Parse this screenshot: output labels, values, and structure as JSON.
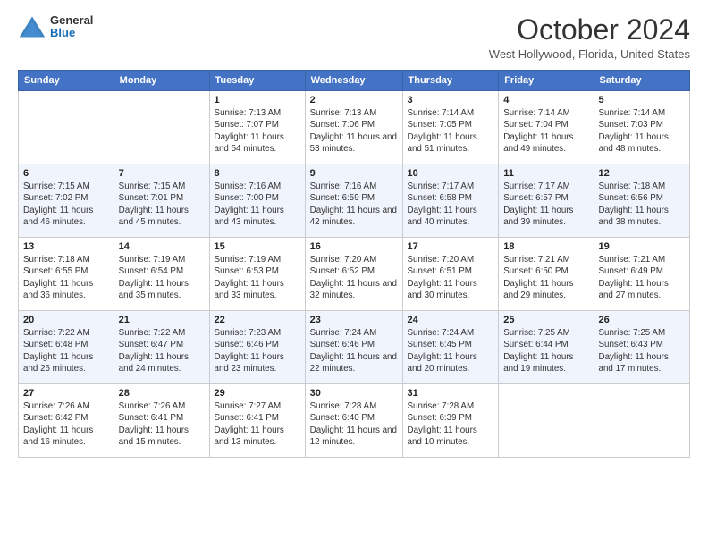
{
  "header": {
    "logo": {
      "general": "General",
      "blue": "Blue"
    },
    "title": "October 2024",
    "location": "West Hollywood, Florida, United States"
  },
  "days_of_week": [
    "Sunday",
    "Monday",
    "Tuesday",
    "Wednesday",
    "Thursday",
    "Friday",
    "Saturday"
  ],
  "weeks": [
    [
      {
        "day": "",
        "info": ""
      },
      {
        "day": "",
        "info": ""
      },
      {
        "day": "1",
        "info": "Sunrise: 7:13 AM\nSunset: 7:07 PM\nDaylight: 11 hours and 54 minutes."
      },
      {
        "day": "2",
        "info": "Sunrise: 7:13 AM\nSunset: 7:06 PM\nDaylight: 11 hours and 53 minutes."
      },
      {
        "day": "3",
        "info": "Sunrise: 7:14 AM\nSunset: 7:05 PM\nDaylight: 11 hours and 51 minutes."
      },
      {
        "day": "4",
        "info": "Sunrise: 7:14 AM\nSunset: 7:04 PM\nDaylight: 11 hours and 49 minutes."
      },
      {
        "day": "5",
        "info": "Sunrise: 7:14 AM\nSunset: 7:03 PM\nDaylight: 11 hours and 48 minutes."
      }
    ],
    [
      {
        "day": "6",
        "info": "Sunrise: 7:15 AM\nSunset: 7:02 PM\nDaylight: 11 hours and 46 minutes."
      },
      {
        "day": "7",
        "info": "Sunrise: 7:15 AM\nSunset: 7:01 PM\nDaylight: 11 hours and 45 minutes."
      },
      {
        "day": "8",
        "info": "Sunrise: 7:16 AM\nSunset: 7:00 PM\nDaylight: 11 hours and 43 minutes."
      },
      {
        "day": "9",
        "info": "Sunrise: 7:16 AM\nSunset: 6:59 PM\nDaylight: 11 hours and 42 minutes."
      },
      {
        "day": "10",
        "info": "Sunrise: 7:17 AM\nSunset: 6:58 PM\nDaylight: 11 hours and 40 minutes."
      },
      {
        "day": "11",
        "info": "Sunrise: 7:17 AM\nSunset: 6:57 PM\nDaylight: 11 hours and 39 minutes."
      },
      {
        "day": "12",
        "info": "Sunrise: 7:18 AM\nSunset: 6:56 PM\nDaylight: 11 hours and 38 minutes."
      }
    ],
    [
      {
        "day": "13",
        "info": "Sunrise: 7:18 AM\nSunset: 6:55 PM\nDaylight: 11 hours and 36 minutes."
      },
      {
        "day": "14",
        "info": "Sunrise: 7:19 AM\nSunset: 6:54 PM\nDaylight: 11 hours and 35 minutes."
      },
      {
        "day": "15",
        "info": "Sunrise: 7:19 AM\nSunset: 6:53 PM\nDaylight: 11 hours and 33 minutes."
      },
      {
        "day": "16",
        "info": "Sunrise: 7:20 AM\nSunset: 6:52 PM\nDaylight: 11 hours and 32 minutes."
      },
      {
        "day": "17",
        "info": "Sunrise: 7:20 AM\nSunset: 6:51 PM\nDaylight: 11 hours and 30 minutes."
      },
      {
        "day": "18",
        "info": "Sunrise: 7:21 AM\nSunset: 6:50 PM\nDaylight: 11 hours and 29 minutes."
      },
      {
        "day": "19",
        "info": "Sunrise: 7:21 AM\nSunset: 6:49 PM\nDaylight: 11 hours and 27 minutes."
      }
    ],
    [
      {
        "day": "20",
        "info": "Sunrise: 7:22 AM\nSunset: 6:48 PM\nDaylight: 11 hours and 26 minutes."
      },
      {
        "day": "21",
        "info": "Sunrise: 7:22 AM\nSunset: 6:47 PM\nDaylight: 11 hours and 24 minutes."
      },
      {
        "day": "22",
        "info": "Sunrise: 7:23 AM\nSunset: 6:46 PM\nDaylight: 11 hours and 23 minutes."
      },
      {
        "day": "23",
        "info": "Sunrise: 7:24 AM\nSunset: 6:46 PM\nDaylight: 11 hours and 22 minutes."
      },
      {
        "day": "24",
        "info": "Sunrise: 7:24 AM\nSunset: 6:45 PM\nDaylight: 11 hours and 20 minutes."
      },
      {
        "day": "25",
        "info": "Sunrise: 7:25 AM\nSunset: 6:44 PM\nDaylight: 11 hours and 19 minutes."
      },
      {
        "day": "26",
        "info": "Sunrise: 7:25 AM\nSunset: 6:43 PM\nDaylight: 11 hours and 17 minutes."
      }
    ],
    [
      {
        "day": "27",
        "info": "Sunrise: 7:26 AM\nSunset: 6:42 PM\nDaylight: 11 hours and 16 minutes."
      },
      {
        "day": "28",
        "info": "Sunrise: 7:26 AM\nSunset: 6:41 PM\nDaylight: 11 hours and 15 minutes."
      },
      {
        "day": "29",
        "info": "Sunrise: 7:27 AM\nSunset: 6:41 PM\nDaylight: 11 hours and 13 minutes."
      },
      {
        "day": "30",
        "info": "Sunrise: 7:28 AM\nSunset: 6:40 PM\nDaylight: 11 hours and 12 minutes."
      },
      {
        "day": "31",
        "info": "Sunrise: 7:28 AM\nSunset: 6:39 PM\nDaylight: 11 hours and 10 minutes."
      },
      {
        "day": "",
        "info": ""
      },
      {
        "day": "",
        "info": ""
      }
    ]
  ]
}
